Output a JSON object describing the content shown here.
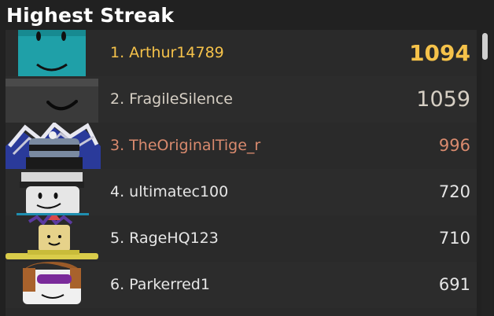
{
  "leaderboard": {
    "title": "Highest Streak",
    "entries": [
      {
        "rank_name": "1. Arthur14789",
        "score": "1094"
      },
      {
        "rank_name": "2. FragileSilence",
        "score": "1059"
      },
      {
        "rank_name": "3. TheOriginalTige_r",
        "score": "996"
      },
      {
        "rank_name": "4. ultimatec100",
        "score": "720"
      },
      {
        "rank_name": "5. RageHQ123",
        "score": "710"
      },
      {
        "rank_name": "6. Parkerred1",
        "score": "691"
      }
    ]
  },
  "colors": {
    "background": "#212121",
    "first_place": "#f5c24a",
    "second_place": "#d6cfc4",
    "third_place": "#d98a6e",
    "default_text": "#e6e6e6"
  }
}
